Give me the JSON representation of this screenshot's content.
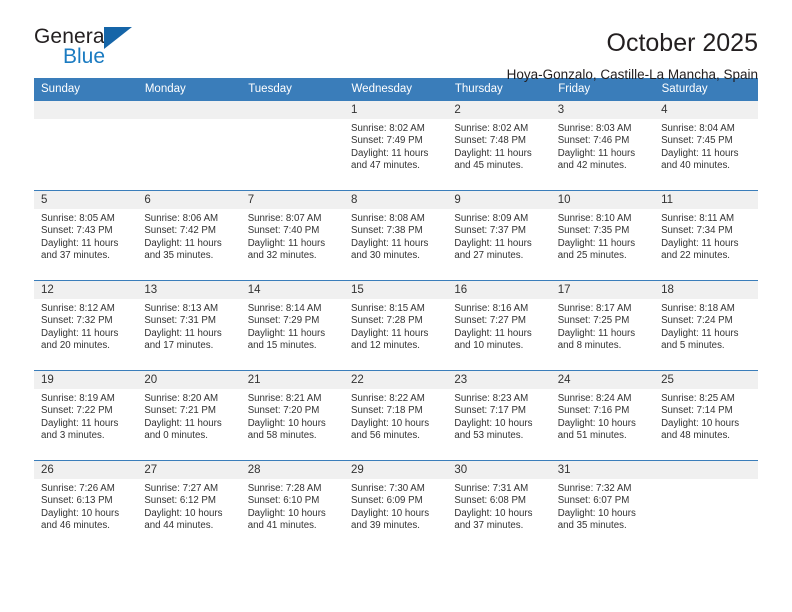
{
  "brand": {
    "name_part1": "General",
    "name_part2": "Blue",
    "accent_color": "#1b7bc1",
    "triangle_color": "#1565a8"
  },
  "header": {
    "title": "October 2025",
    "subtitle": "Hoya-Gonzalo, Castille-La Mancha, Spain"
  },
  "calendar": {
    "header_bg": "#3a7dba",
    "weekdays": [
      "Sunday",
      "Monday",
      "Tuesday",
      "Wednesday",
      "Thursday",
      "Friday",
      "Saturday"
    ],
    "weeks": [
      [
        {
          "day": "",
          "empty": true
        },
        {
          "day": "",
          "empty": true
        },
        {
          "day": "",
          "empty": true
        },
        {
          "day": "1",
          "sunrise": "Sunrise: 8:02 AM",
          "sunset": "Sunset: 7:49 PM",
          "daylight1": "Daylight: 11 hours",
          "daylight2": "and 47 minutes."
        },
        {
          "day": "2",
          "sunrise": "Sunrise: 8:02 AM",
          "sunset": "Sunset: 7:48 PM",
          "daylight1": "Daylight: 11 hours",
          "daylight2": "and 45 minutes."
        },
        {
          "day": "3",
          "sunrise": "Sunrise: 8:03 AM",
          "sunset": "Sunset: 7:46 PM",
          "daylight1": "Daylight: 11 hours",
          "daylight2": "and 42 minutes."
        },
        {
          "day": "4",
          "sunrise": "Sunrise: 8:04 AM",
          "sunset": "Sunset: 7:45 PM",
          "daylight1": "Daylight: 11 hours",
          "daylight2": "and 40 minutes."
        }
      ],
      [
        {
          "day": "5",
          "sunrise": "Sunrise: 8:05 AM",
          "sunset": "Sunset: 7:43 PM",
          "daylight1": "Daylight: 11 hours",
          "daylight2": "and 37 minutes."
        },
        {
          "day": "6",
          "sunrise": "Sunrise: 8:06 AM",
          "sunset": "Sunset: 7:42 PM",
          "daylight1": "Daylight: 11 hours",
          "daylight2": "and 35 minutes."
        },
        {
          "day": "7",
          "sunrise": "Sunrise: 8:07 AM",
          "sunset": "Sunset: 7:40 PM",
          "daylight1": "Daylight: 11 hours",
          "daylight2": "and 32 minutes."
        },
        {
          "day": "8",
          "sunrise": "Sunrise: 8:08 AM",
          "sunset": "Sunset: 7:38 PM",
          "daylight1": "Daylight: 11 hours",
          "daylight2": "and 30 minutes."
        },
        {
          "day": "9",
          "sunrise": "Sunrise: 8:09 AM",
          "sunset": "Sunset: 7:37 PM",
          "daylight1": "Daylight: 11 hours",
          "daylight2": "and 27 minutes."
        },
        {
          "day": "10",
          "sunrise": "Sunrise: 8:10 AM",
          "sunset": "Sunset: 7:35 PM",
          "daylight1": "Daylight: 11 hours",
          "daylight2": "and 25 minutes."
        },
        {
          "day": "11",
          "sunrise": "Sunrise: 8:11 AM",
          "sunset": "Sunset: 7:34 PM",
          "daylight1": "Daylight: 11 hours",
          "daylight2": "and 22 minutes."
        }
      ],
      [
        {
          "day": "12",
          "sunrise": "Sunrise: 8:12 AM",
          "sunset": "Sunset: 7:32 PM",
          "daylight1": "Daylight: 11 hours",
          "daylight2": "and 20 minutes."
        },
        {
          "day": "13",
          "sunrise": "Sunrise: 8:13 AM",
          "sunset": "Sunset: 7:31 PM",
          "daylight1": "Daylight: 11 hours",
          "daylight2": "and 17 minutes."
        },
        {
          "day": "14",
          "sunrise": "Sunrise: 8:14 AM",
          "sunset": "Sunset: 7:29 PM",
          "daylight1": "Daylight: 11 hours",
          "daylight2": "and 15 minutes."
        },
        {
          "day": "15",
          "sunrise": "Sunrise: 8:15 AM",
          "sunset": "Sunset: 7:28 PM",
          "daylight1": "Daylight: 11 hours",
          "daylight2": "and 12 minutes."
        },
        {
          "day": "16",
          "sunrise": "Sunrise: 8:16 AM",
          "sunset": "Sunset: 7:27 PM",
          "daylight1": "Daylight: 11 hours",
          "daylight2": "and 10 minutes."
        },
        {
          "day": "17",
          "sunrise": "Sunrise: 8:17 AM",
          "sunset": "Sunset: 7:25 PM",
          "daylight1": "Daylight: 11 hours",
          "daylight2": "and 8 minutes."
        },
        {
          "day": "18",
          "sunrise": "Sunrise: 8:18 AM",
          "sunset": "Sunset: 7:24 PM",
          "daylight1": "Daylight: 11 hours",
          "daylight2": "and 5 minutes."
        }
      ],
      [
        {
          "day": "19",
          "sunrise": "Sunrise: 8:19 AM",
          "sunset": "Sunset: 7:22 PM",
          "daylight1": "Daylight: 11 hours",
          "daylight2": "and 3 minutes."
        },
        {
          "day": "20",
          "sunrise": "Sunrise: 8:20 AM",
          "sunset": "Sunset: 7:21 PM",
          "daylight1": "Daylight: 11 hours",
          "daylight2": "and 0 minutes."
        },
        {
          "day": "21",
          "sunrise": "Sunrise: 8:21 AM",
          "sunset": "Sunset: 7:20 PM",
          "daylight1": "Daylight: 10 hours",
          "daylight2": "and 58 minutes."
        },
        {
          "day": "22",
          "sunrise": "Sunrise: 8:22 AM",
          "sunset": "Sunset: 7:18 PM",
          "daylight1": "Daylight: 10 hours",
          "daylight2": "and 56 minutes."
        },
        {
          "day": "23",
          "sunrise": "Sunrise: 8:23 AM",
          "sunset": "Sunset: 7:17 PM",
          "daylight1": "Daylight: 10 hours",
          "daylight2": "and 53 minutes."
        },
        {
          "day": "24",
          "sunrise": "Sunrise: 8:24 AM",
          "sunset": "Sunset: 7:16 PM",
          "daylight1": "Daylight: 10 hours",
          "daylight2": "and 51 minutes."
        },
        {
          "day": "25",
          "sunrise": "Sunrise: 8:25 AM",
          "sunset": "Sunset: 7:14 PM",
          "daylight1": "Daylight: 10 hours",
          "daylight2": "and 48 minutes."
        }
      ],
      [
        {
          "day": "26",
          "sunrise": "Sunrise: 7:26 AM",
          "sunset": "Sunset: 6:13 PM",
          "daylight1": "Daylight: 10 hours",
          "daylight2": "and 46 minutes."
        },
        {
          "day": "27",
          "sunrise": "Sunrise: 7:27 AM",
          "sunset": "Sunset: 6:12 PM",
          "daylight1": "Daylight: 10 hours",
          "daylight2": "and 44 minutes."
        },
        {
          "day": "28",
          "sunrise": "Sunrise: 7:28 AM",
          "sunset": "Sunset: 6:10 PM",
          "daylight1": "Daylight: 10 hours",
          "daylight2": "and 41 minutes."
        },
        {
          "day": "29",
          "sunrise": "Sunrise: 7:30 AM",
          "sunset": "Sunset: 6:09 PM",
          "daylight1": "Daylight: 10 hours",
          "daylight2": "and 39 minutes."
        },
        {
          "day": "30",
          "sunrise": "Sunrise: 7:31 AM",
          "sunset": "Sunset: 6:08 PM",
          "daylight1": "Daylight: 10 hours",
          "daylight2": "and 37 minutes."
        },
        {
          "day": "31",
          "sunrise": "Sunrise: 7:32 AM",
          "sunset": "Sunset: 6:07 PM",
          "daylight1": "Daylight: 10 hours",
          "daylight2": "and 35 minutes."
        },
        {
          "day": "",
          "empty": true
        }
      ]
    ]
  }
}
